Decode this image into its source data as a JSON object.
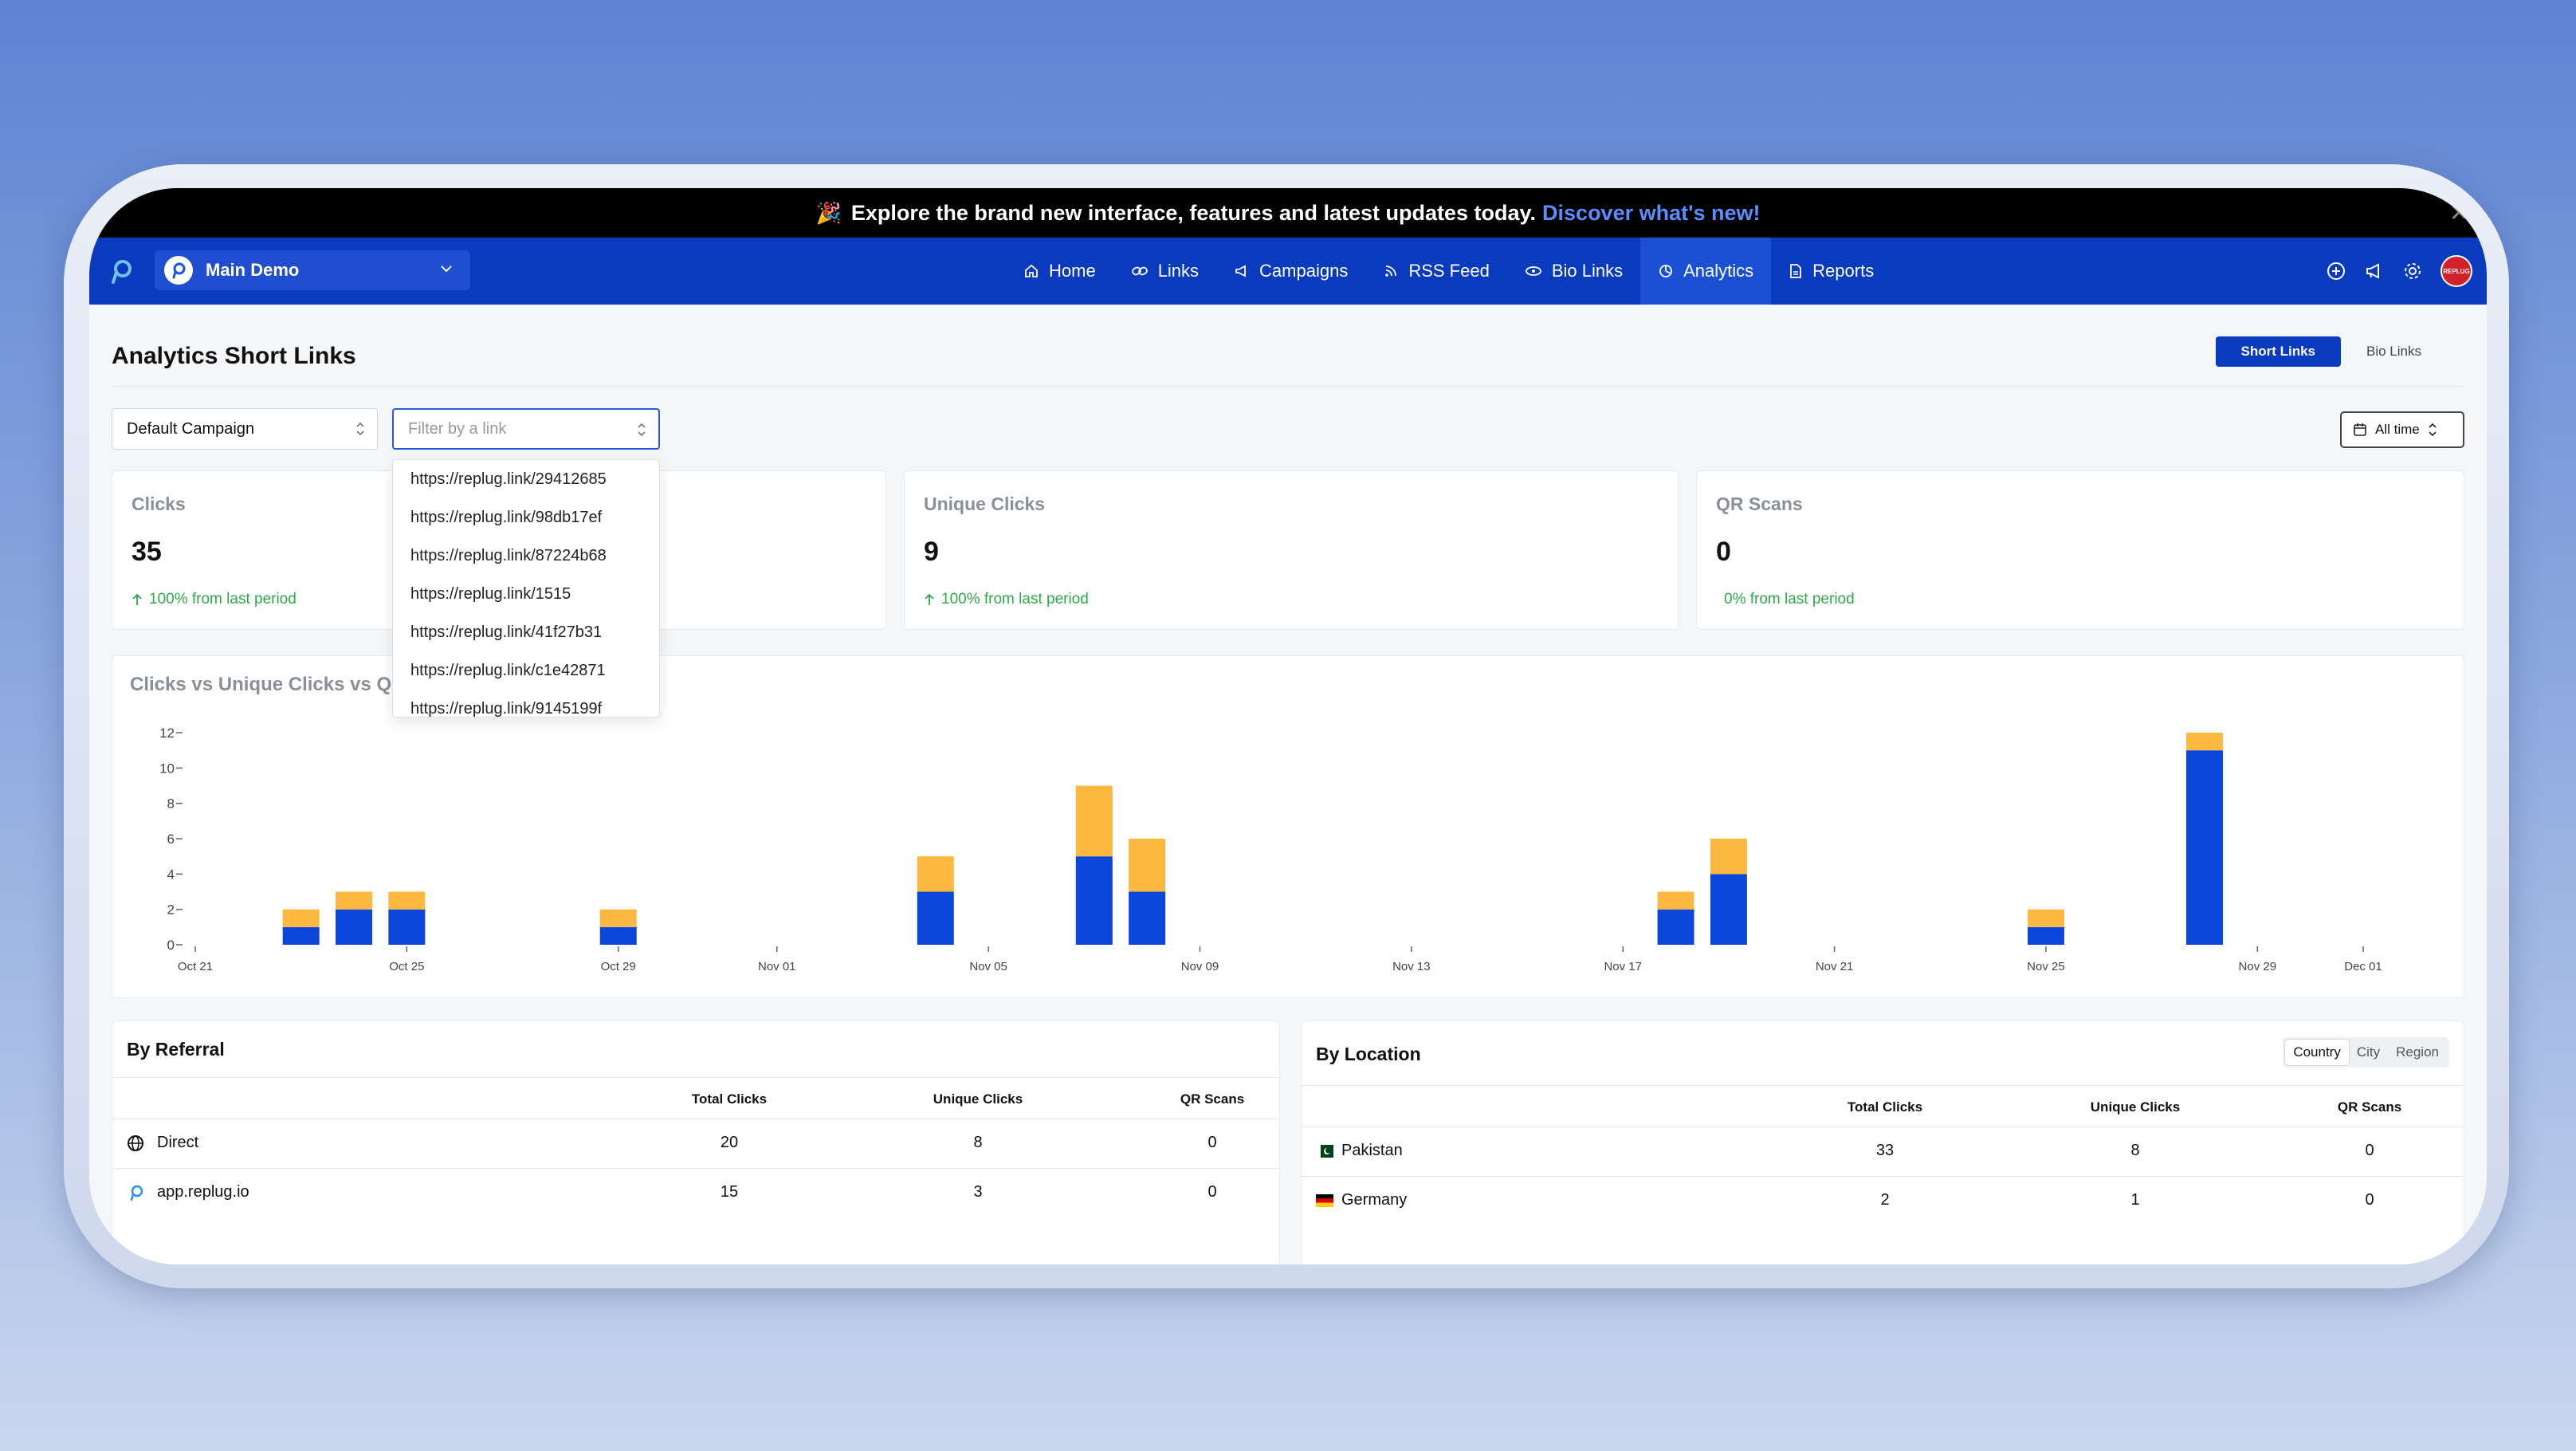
{
  "banner": {
    "emoji": "🎉",
    "text": "Explore the brand new interface, features and latest updates today.",
    "link": "Discover what's new!"
  },
  "nav": {
    "workspace": "Main Demo",
    "items": [
      {
        "label": "Home",
        "icon": "home-icon"
      },
      {
        "label": "Links",
        "icon": "link-icon"
      },
      {
        "label": "Campaigns",
        "icon": "megaphone-icon"
      },
      {
        "label": "RSS Feed",
        "icon": "rss-icon"
      },
      {
        "label": "Bio Links",
        "icon": "bio-link-icon"
      },
      {
        "label": "Analytics",
        "icon": "analytics-icon"
      },
      {
        "label": "Reports",
        "icon": "report-icon"
      }
    ],
    "active": "Analytics",
    "avatar_text": "REPLUG"
  },
  "page": {
    "title": "Analytics Short Links",
    "tabs": [
      "Short Links",
      "Bio Links"
    ],
    "campaign_select": "Default Campaign",
    "link_filter_placeholder": "Filter by a link",
    "date_range": "All time"
  },
  "dropdown_options": [
    "https://replug.link/29412685",
    "https://replug.link/98db17ef",
    "https://replug.link/87224b68",
    "https://replug.link/1515",
    "https://replug.link/41f27b31",
    "https://replug.link/c1e42871",
    "https://replug.link/9145199f"
  ],
  "stats": [
    {
      "label": "Clicks",
      "value": "35",
      "delta": "100% from last period",
      "arrow": true
    },
    {
      "label": "Unique Clicks",
      "value": "9",
      "delta": "100% from last period",
      "arrow": true
    },
    {
      "label": "QR Scans",
      "value": "0",
      "delta": "0% from last period",
      "arrow": false
    }
  ],
  "chart_title": "Clicks vs Unique Clicks vs QR",
  "chart_data": {
    "type": "bar",
    "stacked": true,
    "x_ticks": [
      "Oct 21",
      "Oct 25",
      "Oct 29",
      "Nov 01",
      "Nov 05",
      "Nov 09",
      "Nov 13",
      "Nov 17",
      "Nov 21",
      "Nov 25",
      "Nov 29",
      "Dec 01"
    ],
    "y_ticks": [
      0,
      2,
      4,
      6,
      8,
      10,
      12
    ],
    "ylim": [
      0,
      12
    ],
    "colors": {
      "unique": "#0a46d9",
      "clicks": "#fdb840"
    },
    "bars": [
      {
        "date": "Oct 23",
        "unique": 1,
        "other": 1
      },
      {
        "date": "Oct 24",
        "unique": 2,
        "other": 1
      },
      {
        "date": "Oct 25",
        "unique": 2,
        "other": 1
      },
      {
        "date": "Oct 29",
        "unique": 1,
        "other": 1
      },
      {
        "date": "Nov 04",
        "unique": 3,
        "other": 2
      },
      {
        "date": "Nov 07",
        "unique": 5,
        "other": 4
      },
      {
        "date": "Nov 08",
        "unique": 3,
        "other": 3
      },
      {
        "date": "Nov 18",
        "unique": 2,
        "other": 1
      },
      {
        "date": "Nov 19",
        "unique": 4,
        "other": 2
      },
      {
        "date": "Nov 25",
        "unique": 1,
        "other": 1
      },
      {
        "date": "Nov 28",
        "unique": 11,
        "other": 1
      }
    ]
  },
  "referral": {
    "title": "By Referral",
    "columns": [
      "Total Clicks",
      "Unique Clicks",
      "QR Scans"
    ],
    "rows": [
      {
        "name": "Direct",
        "icon": "globe-icon",
        "total": "20",
        "unique": "8",
        "qr": "0"
      },
      {
        "name": "app.replug.io",
        "icon": "replug-icon",
        "total": "15",
        "unique": "3",
        "qr": "0"
      }
    ]
  },
  "location": {
    "title": "By Location",
    "tabs": [
      "Country",
      "City",
      "Region"
    ],
    "columns": [
      "Total Clicks",
      "Unique Clicks",
      "QR Scans"
    ],
    "rows": [
      {
        "name": "Pakistan",
        "icon": "pakistan-flag-icon",
        "total": "33",
        "unique": "8",
        "qr": "0"
      },
      {
        "name": "Germany",
        "icon": "germany-flag-icon",
        "total": "2",
        "unique": "1",
        "qr": "0"
      }
    ]
  }
}
